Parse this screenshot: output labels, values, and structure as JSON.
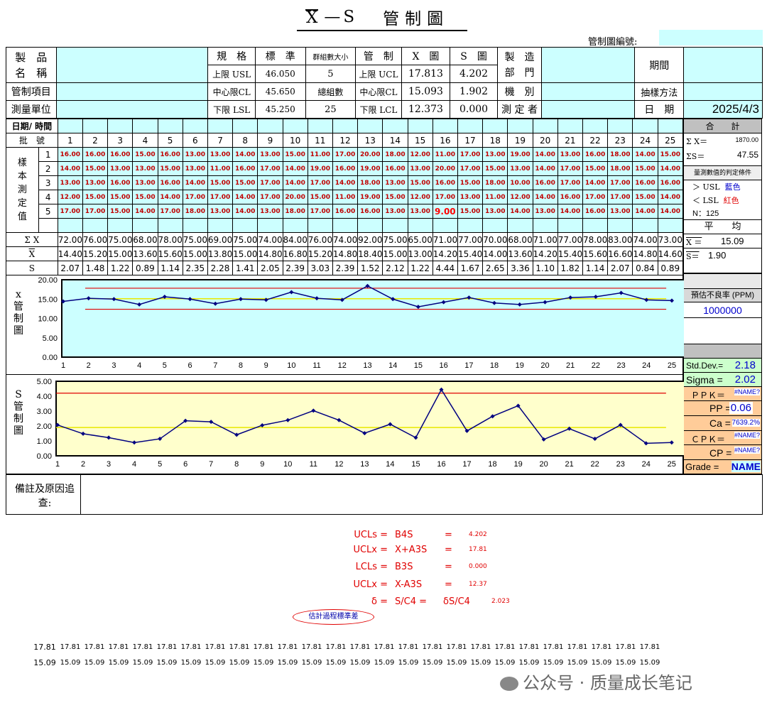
{
  "title": {
    "x_label": "X",
    "dash": "—",
    "s_label": "S",
    "main": "管制圖"
  },
  "chart_no_label": "管制圖編號:",
  "header": {
    "product_name": "製　品\n名　稱",
    "spec": "規　格",
    "std": "標　準",
    "group_size_label": "群組數大小",
    "ctrl": "管　制",
    "xbar_fig": "X　圖",
    "s_fig": "S　圖",
    "dept": "製　造\n部　門",
    "period": "期間",
    "usl_label": "上限 USL",
    "usl": "46.050",
    "group_size": "5",
    "ucl_label": "上限 UCL",
    "ucl_x": "17.813",
    "ucl_s": "4.202",
    "ctrl_item": "管制項目",
    "cl_label": "中心限CL",
    "cl": "45.650",
    "total_groups_label": "總組數",
    "ccl_label": "中心限CL",
    "cl_x": "15.093",
    "cl_s": "1.902",
    "machine": "機　別",
    "sampling": "抽樣方法",
    "unit": "測量單位",
    "lsl_label": "下限 LSL",
    "lsl": "45.250",
    "total_groups": "25",
    "lcl_label": "下限 LCL",
    "lcl_x": "12.373",
    "lcl_s": "0.000",
    "measurer": "測 定 者",
    "date_label": "日　期",
    "date": "2025/4/3"
  },
  "grid": {
    "date_time": "日期/ 時間",
    "batch": "批　號",
    "sample_label": "樣本測定值",
    "batches": [
      "1",
      "2",
      "3",
      "4",
      "5",
      "6",
      "7",
      "8",
      "9",
      "10",
      "11",
      "12",
      "13",
      "14",
      "15",
      "16",
      "17",
      "18",
      "19",
      "20",
      "21",
      "22",
      "23",
      "24",
      "25"
    ],
    "rows": [
      {
        "n": "1",
        "v": [
          "16.00",
          "16.00",
          "16.00",
          "15.00",
          "16.00",
          "13.00",
          "13.00",
          "14.00",
          "13.00",
          "15.00",
          "11.00",
          "17.00",
          "20.00",
          "18.00",
          "12.00",
          "11.00",
          "17.00",
          "13.00",
          "19.00",
          "14.00",
          "13.00",
          "16.00",
          "18.00",
          "14.00",
          "15.00"
        ]
      },
      {
        "n": "2",
        "v": [
          "14.00",
          "15.00",
          "13.00",
          "13.00",
          "15.00",
          "13.00",
          "11.00",
          "16.00",
          "17.00",
          "14.00",
          "19.00",
          "16.00",
          "19.00",
          "16.00",
          "13.00",
          "20.00",
          "17.00",
          "15.00",
          "13.00",
          "14.00",
          "17.00",
          "15.00",
          "18.00",
          "15.00",
          "14.00"
        ]
      },
      {
        "n": "3",
        "v": [
          "13.00",
          "13.00",
          "16.00",
          "13.00",
          "16.00",
          "14.00",
          "15.00",
          "15.00",
          "17.00",
          "14.00",
          "17.00",
          "14.00",
          "18.00",
          "13.00",
          "15.00",
          "16.00",
          "15.00",
          "18.00",
          "10.00",
          "16.00",
          "17.00",
          "14.00",
          "17.00",
          "16.00",
          "16.00"
        ]
      },
      {
        "n": "4",
        "v": [
          "12.00",
          "15.00",
          "15.00",
          "15.00",
          "14.00",
          "17.00",
          "17.00",
          "14.00",
          "17.00",
          "20.00",
          "15.00",
          "11.00",
          "19.00",
          "15.00",
          "12.00",
          "17.00",
          "13.00",
          "11.00",
          "12.00",
          "14.00",
          "16.00",
          "17.00",
          "17.00",
          "15.00",
          "14.00"
        ]
      },
      {
        "n": "5",
        "v": [
          "17.00",
          "17.00",
          "15.00",
          "14.00",
          "17.00",
          "18.00",
          "13.00",
          "14.00",
          "13.00",
          "18.00",
          "17.00",
          "16.00",
          "16.00",
          "13.00",
          "13.00",
          "9.00",
          "15.00",
          "13.00",
          "14.00",
          "13.00",
          "14.00",
          "16.00",
          "13.00",
          "14.00",
          "14.00"
        ]
      }
    ],
    "sum_label": "Σ X",
    "sums": [
      "72.00",
      "76.00",
      "75.00",
      "68.00",
      "78.00",
      "75.00",
      "69.00",
      "75.00",
      "74.00",
      "84.00",
      "76.00",
      "74.00",
      "92.00",
      "75.00",
      "65.00",
      "71.00",
      "77.00",
      "70.00",
      "68.00",
      "71.00",
      "77.00",
      "78.00",
      "83.00",
      "74.00",
      "73.00"
    ],
    "xbar_label": "X",
    "means": [
      "14.40",
      "15.20",
      "15.00",
      "13.60",
      "15.60",
      "15.00",
      "13.80",
      "15.00",
      "14.80",
      "16.80",
      "15.20",
      "14.80",
      "18.40",
      "15.00",
      "13.00",
      "14.20",
      "15.40",
      "14.00",
      "13.60",
      "14.20",
      "15.40",
      "15.60",
      "16.60",
      "14.80",
      "14.60"
    ],
    "s_label": "S",
    "sds": [
      "2.07",
      "1.48",
      "1.22",
      "0.89",
      "1.14",
      "2.35",
      "2.28",
      "1.41",
      "2.05",
      "2.39",
      "3.03",
      "2.39",
      "1.52",
      "2.12",
      "1.22",
      "4.44",
      "1.67",
      "2.65",
      "3.36",
      "1.10",
      "1.82",
      "1.14",
      "2.07",
      "0.84",
      "0.89"
    ]
  },
  "side": {
    "total": "合　　計",
    "sum_x_label": "Σ X＝",
    "sum_x": "1870.00",
    "sum_s_label": "ΣS＝",
    "sum_s": "47.55",
    "judge": "量測數值的判定條件",
    "gt": "＞ USL",
    "gt_color": "藍色",
    "lt": "＜ LSL",
    "lt_color": "紅色",
    "n": "N：125",
    "avg": "平　　均",
    "xbarbar_label": "X ＝",
    "xbarbar": "15.09",
    "sbar_label": "S＝",
    "sbar": "1.90",
    "ppm_label": "預估不良率 (PPM)",
    "ppm": "1000000",
    "stddev_label": "Std.Dev.=",
    "stddev": "2.18",
    "sigma_label": "Sigma =",
    "sigma": "2.02",
    "ppk_label": "ＰＰＫ＝",
    "ppk": "#NAME?",
    "pp_label": "PP =",
    "pp": "0.06",
    "ca_label": "Ca =",
    "ca": "7639.2%",
    "cpk_label": "ＣＰＫ＝",
    "cpk": "#NAME?",
    "cp_label": "CP =",
    "cp": "#NAME?",
    "grade_label": "Grade =",
    "grade": "NAME"
  },
  "xchart_label": "x\n管\n制\n圖",
  "schart_label": "S\n管\n制\n圖",
  "remark": "備註及原因追\n查:",
  "chart_data": [
    {
      "type": "line",
      "title": "",
      "xlabel": "",
      "ylabel": "",
      "x": [
        1,
        2,
        3,
        4,
        5,
        6,
        7,
        8,
        9,
        10,
        11,
        12,
        13,
        14,
        15,
        16,
        17,
        18,
        19,
        20,
        21,
        22,
        23,
        24,
        25
      ],
      "series": [
        {
          "values": [
            14.4,
            15.2,
            15.0,
            13.6,
            15.6,
            15.0,
            13.8,
            15.0,
            14.8,
            16.8,
            15.2,
            14.8,
            18.4,
            15.0,
            13.0,
            14.2,
            15.4,
            14.0,
            13.6,
            14.2,
            15.4,
            15.6,
            16.6,
            14.8,
            14.6
          ]
        }
      ],
      "ucl": 17.81,
      "cl": 15.09,
      "lcl": 12.37,
      "ylim": [
        0,
        20
      ],
      "yticks": [
        "0.00",
        "5.00",
        "10.00",
        "15.00",
        "20.00"
      ],
      "bg": "#ccffff"
    },
    {
      "type": "line",
      "title": "",
      "xlabel": "",
      "ylabel": "",
      "x": [
        1,
        2,
        3,
        4,
        5,
        6,
        7,
        8,
        9,
        10,
        11,
        12,
        13,
        14,
        15,
        16,
        17,
        18,
        19,
        20,
        21,
        22,
        23,
        24,
        25
      ],
      "series": [
        {
          "values": [
            2.07,
            1.48,
            1.22,
            0.89,
            1.14,
            2.35,
            2.28,
            1.41,
            2.05,
            2.39,
            3.03,
            2.39,
            1.52,
            2.12,
            1.22,
            4.44,
            1.67,
            2.65,
            3.36,
            1.1,
            1.82,
            1.14,
            2.07,
            0.84,
            0.89
          ]
        }
      ],
      "ucl": 4.202,
      "cl": 1.9,
      "lcl": 0,
      "ylim": [
        0,
        5
      ],
      "yticks": [
        "0.00",
        "1.00",
        "2.00",
        "3.00",
        "4.00",
        "5.00"
      ],
      "bg": "#ffffcc"
    }
  ],
  "formulas": [
    {
      "lhs": "UCLs =",
      "rhs": "B4S",
      "eq": "=",
      "val": "4.202"
    },
    {
      "lhs": "UCLx =",
      "rhs": "X+A3S",
      "eq": "=",
      "val": "17.81"
    },
    {
      "lhs": "LCLs =",
      "rhs": "B3S",
      "eq": "=",
      "val": "0.000"
    },
    {
      "lhs": "UCLx =",
      "rhs": "X-A3S",
      "eq": "=",
      "val": "12.37"
    },
    {
      "lhs": "δ =",
      "rhs": "S/C4 =",
      "eq": "δS/C4",
      "val": "2.023"
    }
  ],
  "est_label": "估計過程標準差",
  "bottom_row1": [
    "17.81",
    "17.81",
    "17.81",
    "17.81",
    "17.81",
    "17.81",
    "17.81",
    "17.81",
    "17.81",
    "17.81",
    "17.81",
    "17.81",
    "17.81",
    "17.81",
    "17.81",
    "17.81",
    "17.81",
    "17.81",
    "17.81",
    "17.81",
    "17.81",
    "17.81",
    "17.81",
    "17.81",
    "17.81",
    "17.81"
  ],
  "bottom_row2": [
    "15.09",
    "15.09",
    "15.09",
    "15.09",
    "15.09",
    "15.09",
    "15.09",
    "15.09",
    "15.09",
    "15.09",
    "15.09",
    "15.09",
    "15.09",
    "15.09",
    "15.09",
    "15.09",
    "15.09",
    "15.09",
    "15.09",
    "15.09",
    "15.09",
    "15.09",
    "15.09",
    "15.09",
    "15.09",
    "15.09"
  ],
  "watermark": "公众号 · 质量成长笔记"
}
